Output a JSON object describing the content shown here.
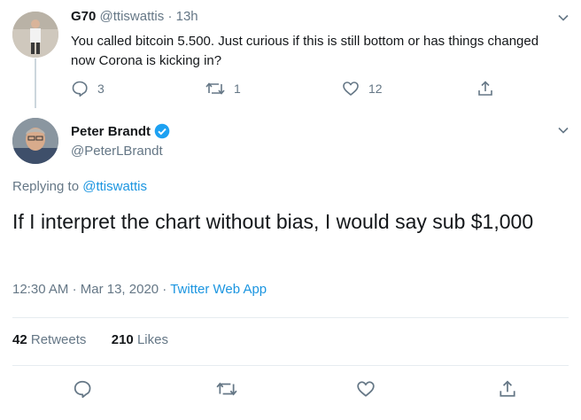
{
  "reply_tweet": {
    "name": "G70",
    "handle": "@ttiswattis",
    "separator": "·",
    "time": "13h",
    "text": "You called bitcoin 5.500. Just curious if this is still bottom or has things changed now Corona is kicking in?",
    "reply_count": "3",
    "retweet_count": "1",
    "like_count": "12"
  },
  "main_tweet": {
    "name": "Peter Brandt",
    "handle": "@PeterLBrandt",
    "replying_prefix": "Replying to",
    "replying_to": "@ttiswattis",
    "text": "If I interpret the chart without bias, I would say sub $1,000",
    "time": "12:30 AM",
    "sep1": "·",
    "date": "Mar 13, 2020",
    "sep2": "·",
    "source": "Twitter Web App",
    "retweets_count": "42",
    "retweets_label": "Retweets",
    "likes_count": "210",
    "likes_label": "Likes"
  },
  "colors": {
    "accent": "#1b95e0",
    "muted": "#657786",
    "verified": "#1da1f2"
  },
  "icons": [
    "reply-icon",
    "retweet-icon",
    "like-icon",
    "share-icon",
    "chevron-down-icon",
    "verified-badge-icon"
  ]
}
